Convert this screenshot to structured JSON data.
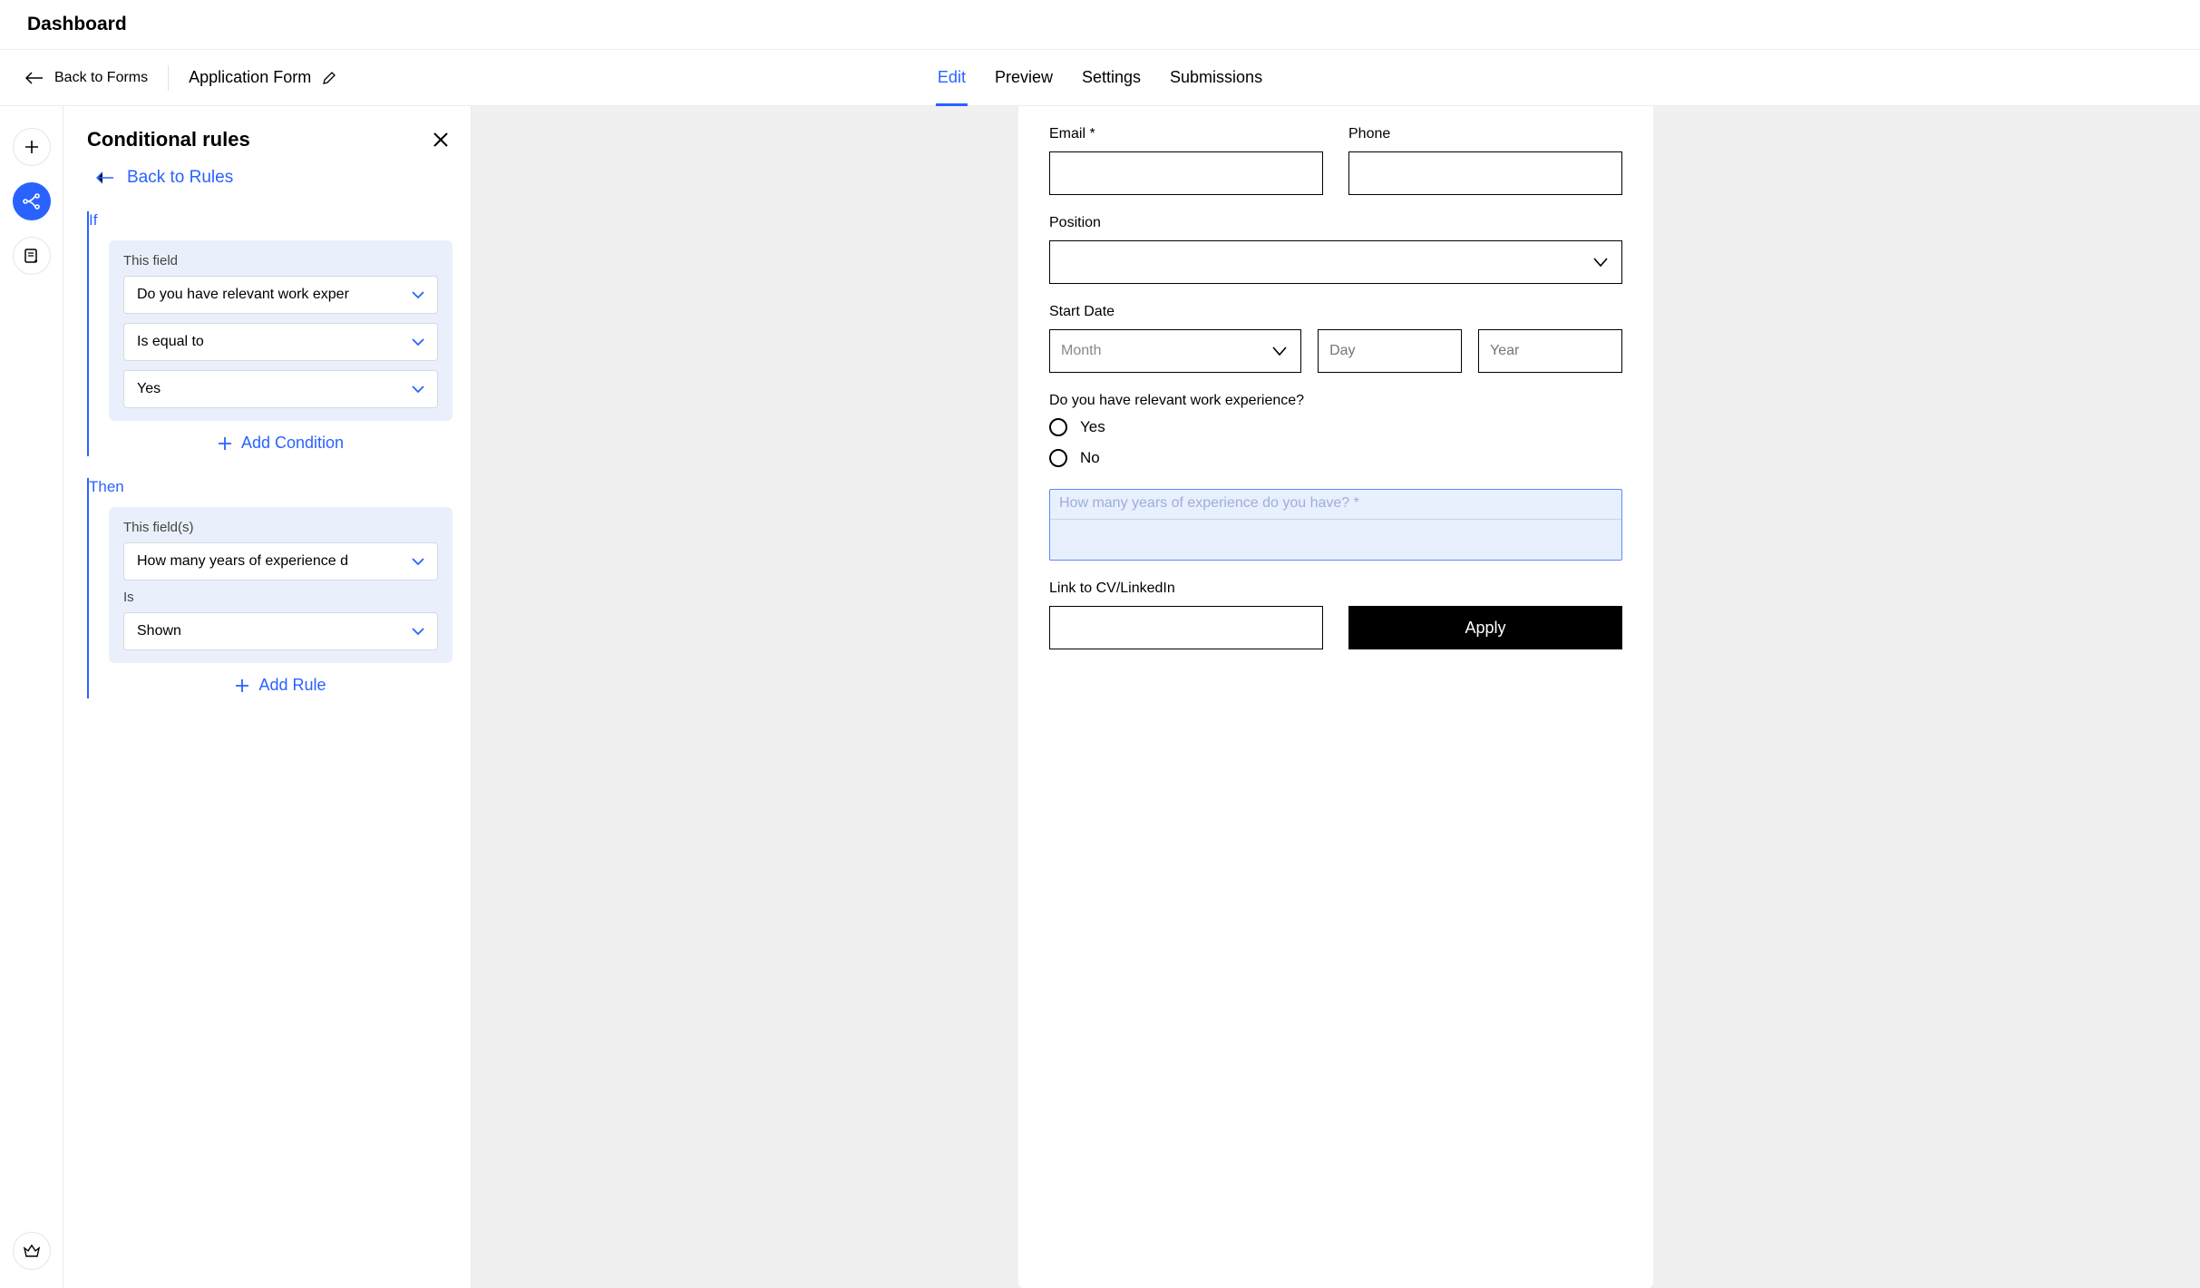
{
  "app": {
    "title": "Dashboard"
  },
  "header": {
    "back_to_forms": "Back to Forms",
    "form_name": "Application Form"
  },
  "tabs": [
    {
      "label": "Edit",
      "active": true
    },
    {
      "label": "Preview",
      "active": false
    },
    {
      "label": "Settings",
      "active": false
    },
    {
      "label": "Submissions",
      "active": false
    }
  ],
  "panel": {
    "title": "Conditional rules",
    "back_link": "Back to Rules",
    "if_label": "If",
    "then_label": "Then",
    "if_block": {
      "this_field_label": "This field",
      "field_value": "Do you have relevant work exper",
      "operator": "Is equal to",
      "value": "Yes",
      "add_condition": "Add Condition"
    },
    "then_block": {
      "this_fields_label": "This field(s)",
      "field_value": "How many years of experience d",
      "is_label": "Is",
      "visibility": "Shown",
      "add_rule": "Add Rule"
    }
  },
  "form": {
    "email_label": "Email *",
    "phone_label": "Phone",
    "position_label": "Position",
    "start_date_label": "Start Date",
    "month_placeholder": "Month",
    "day_placeholder": "Day",
    "year_placeholder": "Year",
    "experience_question": "Do you have relevant work experience?",
    "option_yes": "Yes",
    "option_no": "No",
    "highlight_placeholder": "How many years of experience do you have? *",
    "cv_label": "Link to CV/LinkedIn",
    "apply_button": "Apply"
  },
  "colors": {
    "accent": "#2962ff"
  }
}
